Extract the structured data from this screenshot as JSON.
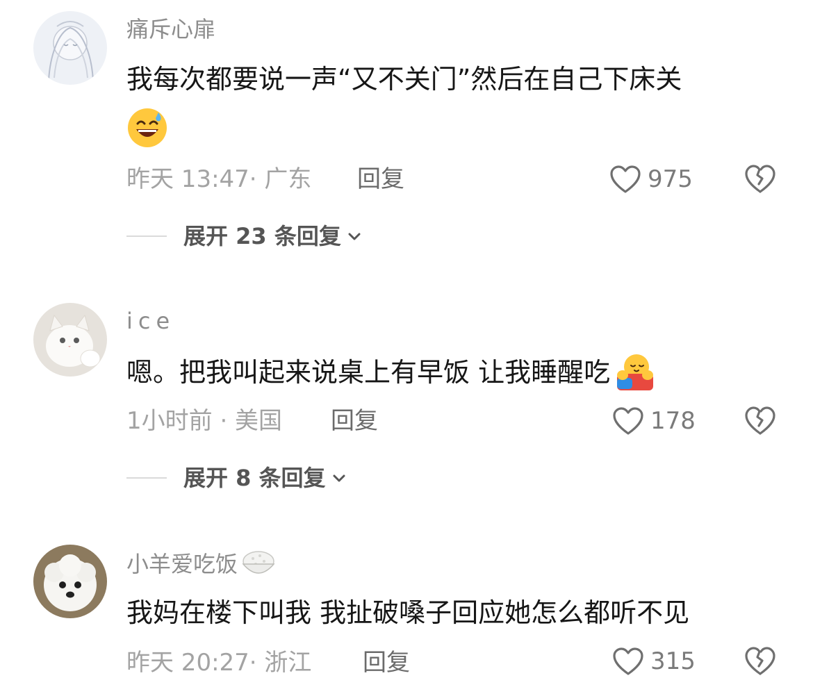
{
  "comments": [
    {
      "username": "痛斥心扉",
      "text": "我每次都要说一声“又不关门”然后在自己下床关",
      "emoji": "grinning-sweat-emoji",
      "time_location": "昨天 13:47· 广东",
      "reply_label": "回复",
      "likes": "975",
      "expand_label": "展开 23 条回复"
    },
    {
      "username": "ice",
      "text": "嗯。把我叫起来说桌上有早饭 让我睡醒吃",
      "emoji": "hugging-face-emoji",
      "time_location": "1小时前 · 美国",
      "reply_label": "回复",
      "likes": "178",
      "expand_label": "展开 8 条回复"
    },
    {
      "username": "小羊爱吃饭",
      "username_emoji": "rice-bowl-emoji",
      "text": "我妈在楼下叫我 我扯破嗓子回应她怎么都听不见",
      "time_location": "昨天 20:27· 浙江",
      "reply_label": "回复",
      "likes": "315"
    }
  ],
  "colors": {
    "username": "#8d8d8d",
    "text": "#161616",
    "meta": "#a3a3a3",
    "reply": "#6b6b6b",
    "expand": "#555555"
  }
}
